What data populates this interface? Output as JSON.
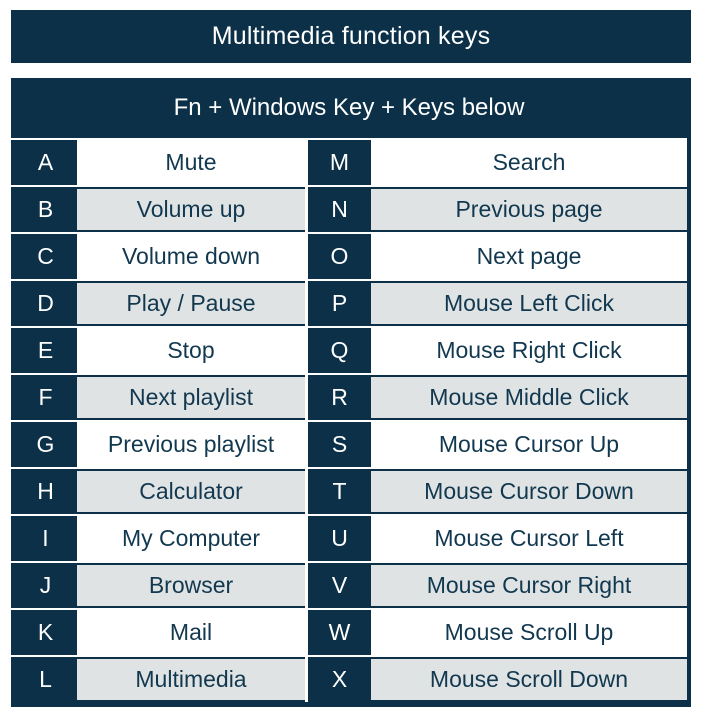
{
  "colors": {
    "navy": "#0B3047",
    "text_navy": "#12384F",
    "shaded_row": "#DFE3E4",
    "white": "#FFFFFF"
  },
  "header": {
    "title": "Multimedia function keys",
    "subtitle": "Fn + Windows Key + Keys below"
  },
  "table": {
    "rows": [
      {
        "left_key": "A",
        "left_desc": "Mute",
        "right_key": "M",
        "right_desc": "Search"
      },
      {
        "left_key": "B",
        "left_desc": "Volume up",
        "right_key": "N",
        "right_desc": "Previous page"
      },
      {
        "left_key": "C",
        "left_desc": "Volume down",
        "right_key": "O",
        "right_desc": "Next page"
      },
      {
        "left_key": "D",
        "left_desc": "Play / Pause",
        "right_key": "P",
        "right_desc": "Mouse Left Click"
      },
      {
        "left_key": "E",
        "left_desc": "Stop",
        "right_key": "Q",
        "right_desc": "Mouse Right Click"
      },
      {
        "left_key": "F",
        "left_desc": "Next playlist",
        "right_key": "R",
        "right_desc": "Mouse Middle Click"
      },
      {
        "left_key": "G",
        "left_desc": "Previous playlist",
        "right_key": "S",
        "right_desc": "Mouse Cursor Up"
      },
      {
        "left_key": "H",
        "left_desc": "Calculator",
        "right_key": "T",
        "right_desc": "Mouse Cursor Down"
      },
      {
        "left_key": "I",
        "left_desc": "My Computer",
        "right_key": "U",
        "right_desc": "Mouse Cursor Left"
      },
      {
        "left_key": "J",
        "left_desc": "Browser",
        "right_key": "V",
        "right_desc": "Mouse Cursor Right"
      },
      {
        "left_key": "K",
        "left_desc": "Mail",
        "right_key": "W",
        "right_desc": "Mouse Scroll Up"
      },
      {
        "left_key": "L",
        "left_desc": "Multimedia",
        "right_key": "X",
        "right_desc": "Mouse Scroll Down"
      }
    ]
  }
}
